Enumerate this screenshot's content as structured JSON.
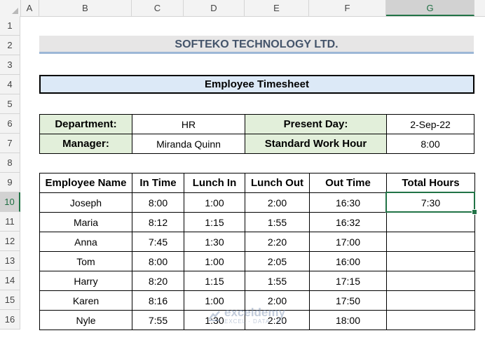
{
  "columns": [
    "A",
    "B",
    "C",
    "D",
    "E",
    "F",
    "G"
  ],
  "rows": [
    "1",
    "2",
    "3",
    "4",
    "5",
    "6",
    "7",
    "8",
    "9",
    "10",
    "11",
    "12",
    "13",
    "14",
    "15",
    "16"
  ],
  "title": "SOFTEKO TECHNOLOGY LTD.",
  "subtitle": "Employee Timesheet",
  "info": {
    "department_label": "Department:",
    "department_value": "HR",
    "manager_label": "Manager:",
    "manager_value": "Miranda Quinn",
    "present_day_label": "Present Day:",
    "present_day_value": "2-Sep-22",
    "standard_label": "Standard Work Hour",
    "standard_value": "8:00"
  },
  "table": {
    "headers": [
      "Employee Name",
      "In Time",
      "Lunch In",
      "Lunch Out",
      "Out Time",
      "Total Hours"
    ],
    "rows": [
      [
        "Joseph",
        "8:00",
        "1:00",
        "2:00",
        "16:30",
        "7:30"
      ],
      [
        "Maria",
        "8:12",
        "1:15",
        "1:55",
        "16:32",
        ""
      ],
      [
        "Anna",
        "7:45",
        "1:30",
        "2:20",
        "17:00",
        ""
      ],
      [
        "Tom",
        "8:00",
        "1:00",
        "2:05",
        "16:00",
        ""
      ],
      [
        "Harry",
        "8:20",
        "1:15",
        "1:55",
        "17:15",
        ""
      ],
      [
        "Karen",
        "8:16",
        "1:00",
        "2:00",
        "17:50",
        ""
      ],
      [
        "Nyle",
        "7:55",
        "1:30",
        "2:20",
        "18:00",
        ""
      ]
    ]
  },
  "selected_cell": "G10",
  "watermark": {
    "name": "exceldemy",
    "tagline": "EXCEL · DATA · BI"
  }
}
